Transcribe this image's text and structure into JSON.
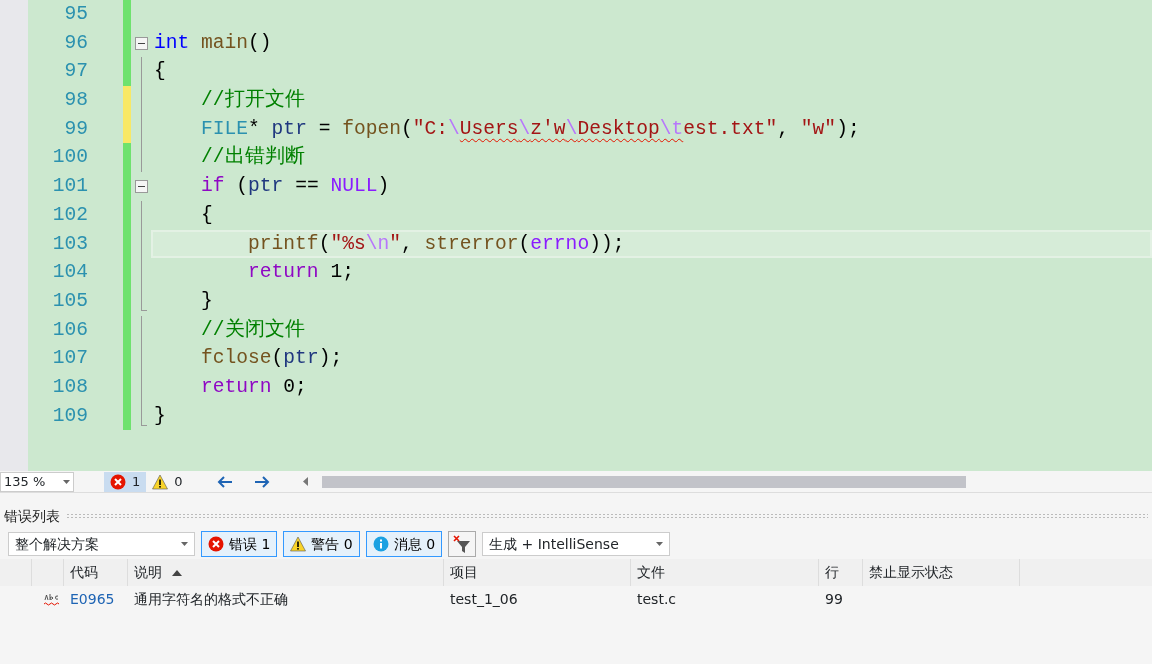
{
  "editor": {
    "lines": [
      {
        "number": "95",
        "unsaved": false,
        "current": false
      },
      {
        "number": "96",
        "unsaved": false,
        "current": false,
        "expanded": true,
        "tokens": [
          {
            "kind": "kw",
            "t": "int "
          },
          {
            "kind": "fn",
            "t": "main"
          },
          {
            "kind": "plain",
            "t": "()"
          }
        ],
        "children": [
          {
            "number": "97",
            "unsaved": false,
            "current": false,
            "tokens": [
              {
                "kind": "plain",
                "t": "{"
              }
            ]
          },
          {
            "number": "98",
            "unsaved": true,
            "current": false,
            "tokens": [
              {
                "kind": "cm",
                "t": "    //打开文件"
              }
            ]
          },
          {
            "number": "99",
            "unsaved": true,
            "current": false,
            "tokens": [
              {
                "kind": "type",
                "t": "    FILE"
              },
              {
                "kind": "plain",
                "t": "* "
              },
              {
                "kind": "var",
                "t": "ptr"
              },
              {
                "kind": "plain",
                "t": " = "
              },
              {
                "kind": "fn",
                "t": "fopen"
              },
              {
                "kind": "plain",
                "t": "("
              },
              {
                "kind": "str",
                "t": "\"C:"
              },
              {
                "kind": "esc",
                "t": "\\"
              },
              {
                "kind": "str",
                "t": "Users",
                "squiggle": true
              },
              {
                "kind": "esc",
                "t": "\\",
                "squiggle": true
              },
              {
                "kind": "str",
                "t": "z'w",
                "squiggle": true
              },
              {
                "kind": "esc",
                "t": "\\",
                "squiggle": true
              },
              {
                "kind": "str",
                "t": "Desktop",
                "squiggle": true
              },
              {
                "kind": "esc",
                "t": "\\t",
                "squiggle": true
              },
              {
                "kind": "str",
                "t": "est.txt\""
              },
              {
                "kind": "plain",
                "t": ", "
              },
              {
                "kind": "str",
                "t": "\"w\""
              },
              {
                "kind": "plain",
                "t": ");"
              }
            ]
          },
          {
            "number": "100",
            "unsaved": false,
            "current": false,
            "tokens": [
              {
                "kind": "cm",
                "t": "    //出错判断"
              }
            ]
          },
          {
            "number": "101",
            "unsaved": false,
            "current": false,
            "expanded": true,
            "tokens": [
              {
                "kind": "kw2",
                "t": "    if"
              },
              {
                "kind": "plain",
                "t": " ("
              },
              {
                "kind": "var",
                "t": "ptr"
              },
              {
                "kind": "plain",
                "t": " == "
              },
              {
                "kind": "macro",
                "t": "NULL"
              },
              {
                "kind": "plain",
                "t": ")"
              }
            ],
            "children": [
              {
                "number": "102",
                "unsaved": false,
                "current": false,
                "tokens": [
                  {
                    "kind": "plain",
                    "t": "    {"
                  }
                ]
              },
              {
                "number": "103",
                "unsaved": false,
                "current": true,
                "tokens": [
                  {
                    "kind": "fn",
                    "t": "        printf"
                  },
                  {
                    "kind": "plain",
                    "t": "("
                  },
                  {
                    "kind": "str",
                    "t": "\"%s"
                  },
                  {
                    "kind": "esc",
                    "t": "\\n"
                  },
                  {
                    "kind": "str",
                    "t": "\""
                  },
                  {
                    "kind": "plain",
                    "t": ", "
                  },
                  {
                    "kind": "fn",
                    "t": "strerror"
                  },
                  {
                    "kind": "plain",
                    "t": "("
                  },
                  {
                    "kind": "macro",
                    "t": "errno"
                  },
                  {
                    "kind": "plain",
                    "t": "));"
                  }
                ]
              },
              {
                "number": "104",
                "unsaved": false,
                "current": false,
                "tokens": [
                  {
                    "kind": "kw2",
                    "t": "        return"
                  },
                  {
                    "kind": "plain",
                    "t": " 1;"
                  }
                ]
              },
              {
                "number": "105",
                "unsaved": false,
                "current": false,
                "tokens": [
                  {
                    "kind": "plain",
                    "t": "    }"
                  }
                ]
              }
            ]
          },
          {
            "number": "106",
            "unsaved": false,
            "current": false,
            "tokens": [
              {
                "kind": "cm",
                "t": "    //关闭文件"
              }
            ]
          },
          {
            "number": "107",
            "unsaved": false,
            "current": false,
            "tokens": [
              {
                "kind": "fn",
                "t": "    fclose"
              },
              {
                "kind": "plain",
                "t": "("
              },
              {
                "kind": "var",
                "t": "ptr"
              },
              {
                "kind": "plain",
                "t": ");"
              }
            ]
          },
          {
            "number": "108",
            "unsaved": false,
            "current": false,
            "tokens": [
              {
                "kind": "kw2",
                "t": "    return"
              },
              {
                "kind": "plain",
                "t": " 0;"
              }
            ]
          },
          {
            "number": "109",
            "unsaved": false,
            "current": false,
            "tokens": [
              {
                "kind": "plain",
                "t": "}"
              }
            ]
          }
        ]
      }
    ]
  },
  "status_strip": {
    "zoom": "135 %",
    "errors": {
      "count": "1",
      "selected": true
    },
    "warnings": {
      "count": "0",
      "selected": false
    }
  },
  "error_list": {
    "title": "错误列表",
    "scope": "整个解决方案",
    "filters": [
      {
        "kind": "error",
        "label": "错误 1",
        "selected": true
      },
      {
        "kind": "warning",
        "label": "警告 0",
        "selected": true
      },
      {
        "kind": "message",
        "label": "消息 0",
        "selected": true
      }
    ],
    "source": "生成 + IntelliSense",
    "columns": [
      {
        "label": "代码",
        "sorted": false
      },
      {
        "label": "说明",
        "sorted": true
      },
      {
        "label": "项目",
        "sorted": false
      },
      {
        "label": "文件",
        "sorted": false
      },
      {
        "label": "行",
        "sorted": false
      },
      {
        "label": "禁止显示状态",
        "sorted": false
      }
    ],
    "rows": [
      {
        "code": "E0965",
        "description": "通用字符名的格式不正确",
        "project": "test_1_06",
        "file": "test.c",
        "line": "99"
      }
    ]
  }
}
